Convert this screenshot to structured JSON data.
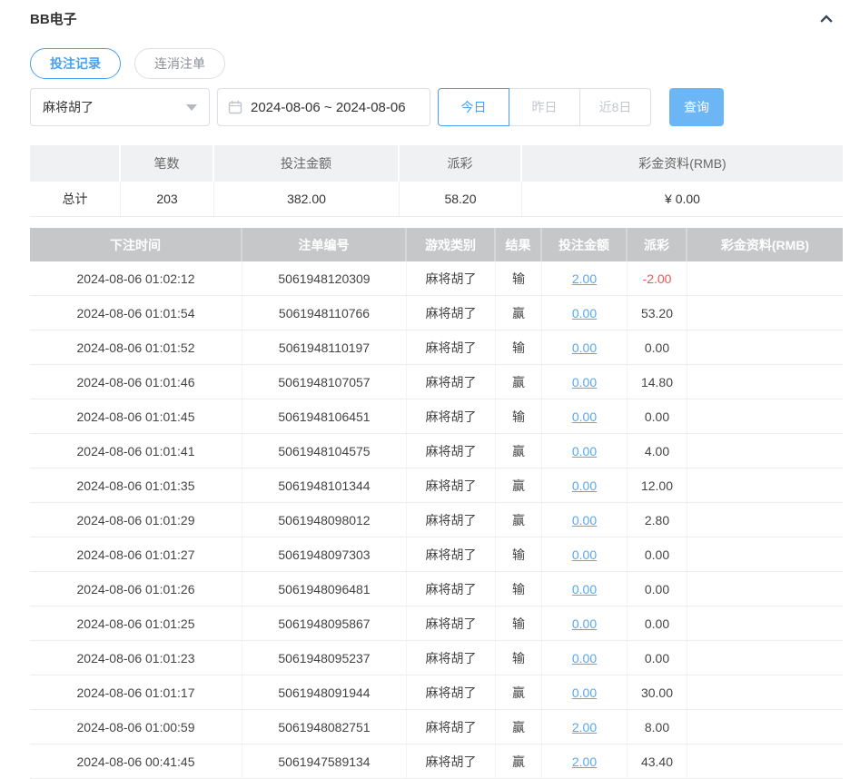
{
  "panel": {
    "title": "BB电子",
    "collapse_icon": "chevron-up-icon"
  },
  "tabs": [
    {
      "label": "投注记录",
      "active": true
    },
    {
      "label": "连消注单",
      "active": false
    }
  ],
  "filters": {
    "game_select": {
      "value": "麻将胡了",
      "caret_icon": "chevron-down-icon"
    },
    "date_range": {
      "value": "2024-08-06 ~ 2024-08-06",
      "calendar_icon": "calendar-icon"
    },
    "quick_ranges": [
      {
        "label": "今日",
        "active": true
      },
      {
        "label": "昨日",
        "active": false
      },
      {
        "label": "近8日",
        "active": false
      }
    ],
    "search_label": "查询"
  },
  "summary": {
    "headers": [
      "",
      "笔数",
      "投注金额",
      "派彩",
      "彩金资料(RMB)"
    ],
    "total": {
      "label": "总计",
      "count": "203",
      "bet_amount": "382.00",
      "payout": "58.20",
      "jackpot": "¥ 0.00"
    }
  },
  "table": {
    "headers": [
      "下注时间",
      "注单编号",
      "游戏类别",
      "结果",
      "投注金额",
      "派彩",
      "彩金资料(RMB)"
    ],
    "records": [
      {
        "time": "2024-08-06 01:02:12",
        "order_no": "5061948120309",
        "game": "麻将胡了",
        "result": "输",
        "bet": "2.00",
        "payout": "-2.00",
        "jackpot": ""
      },
      {
        "time": "2024-08-06 01:01:54",
        "order_no": "5061948110766",
        "game": "麻将胡了",
        "result": "赢",
        "bet": "0.00",
        "payout": "53.20",
        "jackpot": ""
      },
      {
        "time": "2024-08-06 01:01:52",
        "order_no": "5061948110197",
        "game": "麻将胡了",
        "result": "输",
        "bet": "0.00",
        "payout": "0.00",
        "jackpot": ""
      },
      {
        "time": "2024-08-06 01:01:46",
        "order_no": "5061948107057",
        "game": "麻将胡了",
        "result": "赢",
        "bet": "0.00",
        "payout": "14.80",
        "jackpot": ""
      },
      {
        "time": "2024-08-06 01:01:45",
        "order_no": "5061948106451",
        "game": "麻将胡了",
        "result": "输",
        "bet": "0.00",
        "payout": "0.00",
        "jackpot": ""
      },
      {
        "time": "2024-08-06 01:01:41",
        "order_no": "5061948104575",
        "game": "麻将胡了",
        "result": "赢",
        "bet": "0.00",
        "payout": "4.00",
        "jackpot": ""
      },
      {
        "time": "2024-08-06 01:01:35",
        "order_no": "5061948101344",
        "game": "麻将胡了",
        "result": "赢",
        "bet": "0.00",
        "payout": "12.00",
        "jackpot": ""
      },
      {
        "time": "2024-08-06 01:01:29",
        "order_no": "5061948098012",
        "game": "麻将胡了",
        "result": "赢",
        "bet": "0.00",
        "payout": "2.80",
        "jackpot": ""
      },
      {
        "time": "2024-08-06 01:01:27",
        "order_no": "5061948097303",
        "game": "麻将胡了",
        "result": "输",
        "bet": "0.00",
        "payout": "0.00",
        "jackpot": ""
      },
      {
        "time": "2024-08-06 01:01:26",
        "order_no": "5061948096481",
        "game": "麻将胡了",
        "result": "输",
        "bet": "0.00",
        "payout": "0.00",
        "jackpot": ""
      },
      {
        "time": "2024-08-06 01:01:25",
        "order_no": "5061948095867",
        "game": "麻将胡了",
        "result": "输",
        "bet": "0.00",
        "payout": "0.00",
        "jackpot": ""
      },
      {
        "time": "2024-08-06 01:01:23",
        "order_no": "5061948095237",
        "game": "麻将胡了",
        "result": "输",
        "bet": "0.00",
        "payout": "0.00",
        "jackpot": ""
      },
      {
        "time": "2024-08-06 01:01:17",
        "order_no": "5061948091944",
        "game": "麻将胡了",
        "result": "赢",
        "bet": "0.00",
        "payout": "30.00",
        "jackpot": ""
      },
      {
        "time": "2024-08-06 01:00:59",
        "order_no": "5061948082751",
        "game": "麻将胡了",
        "result": "赢",
        "bet": "2.00",
        "payout": "8.00",
        "jackpot": ""
      },
      {
        "time": "2024-08-06 00:41:45",
        "order_no": "5061947589134",
        "game": "麻将胡了",
        "result": "赢",
        "bet": "2.00",
        "payout": "43.40",
        "jackpot": ""
      }
    ]
  },
  "colors": {
    "accent": "#4aa0f0",
    "link": "#58a8ee",
    "negative": "#f05555",
    "search_button_bg": "#6cb6f5",
    "table_header_bg": "#c5c7c9",
    "summary_header_bg": "#f0f1f2"
  }
}
